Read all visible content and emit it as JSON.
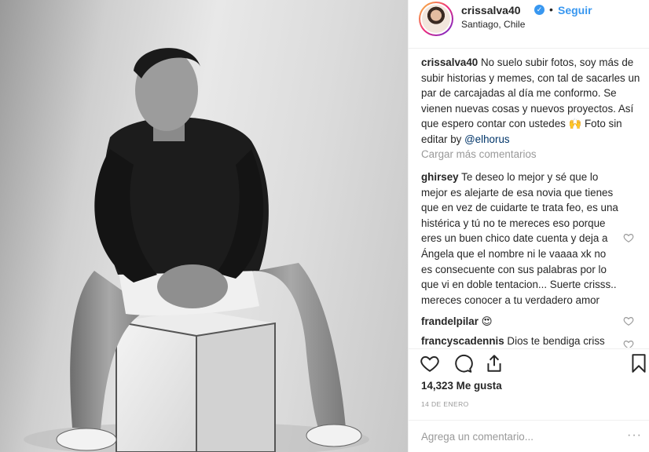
{
  "post": {
    "username": "crissalva40",
    "verified_glyph": "✓",
    "separator": "•",
    "follow_label": "Seguir",
    "location": "Santiago, Chile",
    "photo_icon": "person-seated-on-box-photo"
  },
  "caption": {
    "username": "crissalva40",
    "text": "No suelo subir fotos, soy más de subir historias y memes, con tal de sacarles un par de carcajadas al día me conformo. Se vienen nuevas cosas y nuevos proyectos. Así que espero contar con ustedes 🙌 Foto sin editar by ",
    "mention": "@elhorus"
  },
  "load_more_label": "Cargar más comentarios",
  "comments": [
    {
      "username": "ghirsey",
      "text": "Te deseo lo mejor y sé que lo mejor es alejarte de esa novia que tienes que en vez de cuidarte te trata feo, es una histérica y tú no te mereces eso porque eres un buen chico date cuenta y deja a Ángela que el nombre ni le vaaaa xk no es consecuente con sus palabras por lo que vi en doble tentacion... Suerte crisss.. mereces conocer a tu verdadero amor"
    },
    {
      "username": "frandelpilar",
      "text": "😍"
    },
    {
      "username": "francyscadennis",
      "text": "Dios te bendiga criss"
    }
  ],
  "actions": {
    "like_icon": "heart-icon",
    "comment_icon": "comment-icon",
    "share_icon": "share-icon",
    "save_icon": "bookmark-icon"
  },
  "likes_label": "14,323 Me gusta",
  "date_label": "14 DE ENERO",
  "add_comment_placeholder": "Agrega un comentario...",
  "more_glyph": "···"
}
